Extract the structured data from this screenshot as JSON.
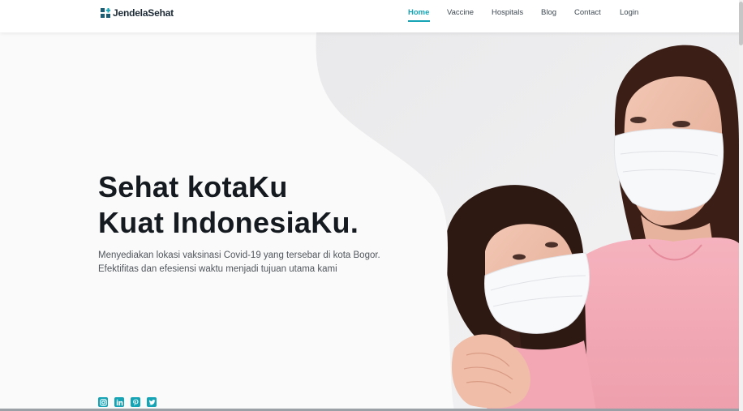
{
  "brand": {
    "name": "JendelaSehat",
    "accent_color": "#14a4b5",
    "logo_icon": "medical-cross-icon"
  },
  "nav": {
    "items": [
      {
        "label": "Home",
        "active": true
      },
      {
        "label": "Vaccine",
        "active": false
      },
      {
        "label": "Hospitals",
        "active": false
      },
      {
        "label": "Blog",
        "active": false
      },
      {
        "label": "Contact",
        "active": false
      },
      {
        "label": "Login",
        "active": false
      }
    ]
  },
  "hero": {
    "headline_line1": "Sehat kotaKu",
    "headline_line2": "Kuat IndonesiaKu.",
    "subtext_line1": "Menyediakan lokasi vaksinasi Covid-19 yang tersebar di kota Bogor.",
    "subtext_line2": "Efektifitas dan efesiensi waktu menjadi tujuan utama kami",
    "image_icon": "masked-mother-daughter-photo"
  },
  "socials": [
    {
      "icon": "instagram-icon"
    },
    {
      "icon": "linkedin-icon"
    },
    {
      "icon": "pinterest-icon"
    },
    {
      "icon": "twitter-icon"
    }
  ]
}
